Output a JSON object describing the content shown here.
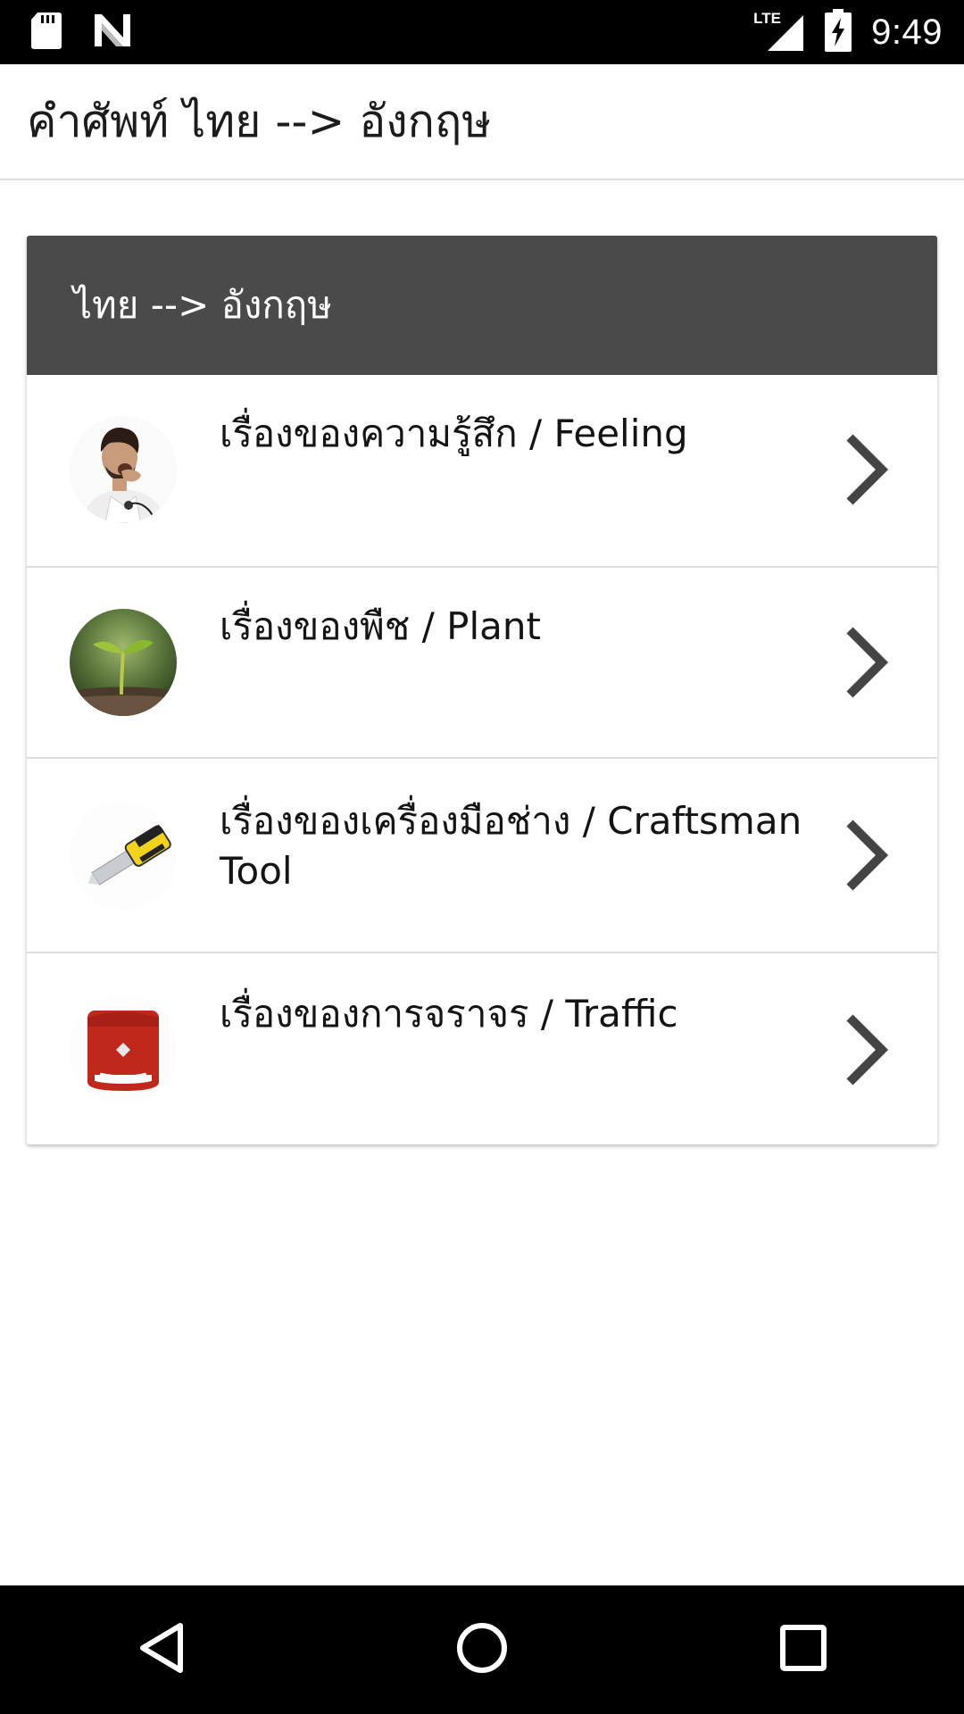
{
  "status_bar": {
    "time": "9:49",
    "network": "LTE",
    "icons": [
      "sd-card-icon",
      "n-logo-icon",
      "lte-signal-icon",
      "battery-charging-icon"
    ]
  },
  "header": {
    "title": "คำศัพท์ ไทย --> อังกฤษ"
  },
  "card": {
    "title": "ไทย --> อังกฤษ",
    "header_color": "#4a4a4a",
    "items": [
      {
        "label": "เรื่องของความรู้สึก / Feeling",
        "icon": "yawning-man-icon"
      },
      {
        "label": "เรื่องของพืช / Plant",
        "icon": "seedling-icon"
      },
      {
        "label": "เรื่องของเครื่องมือช่าง / Craftsman Tool",
        "icon": "utility-knife-icon"
      },
      {
        "label": "เรื่องของการจราจร / Traffic",
        "icon": "red-tag-icon"
      }
    ]
  },
  "nav_bar": {
    "buttons": [
      "back-icon",
      "home-icon",
      "recents-icon"
    ]
  }
}
